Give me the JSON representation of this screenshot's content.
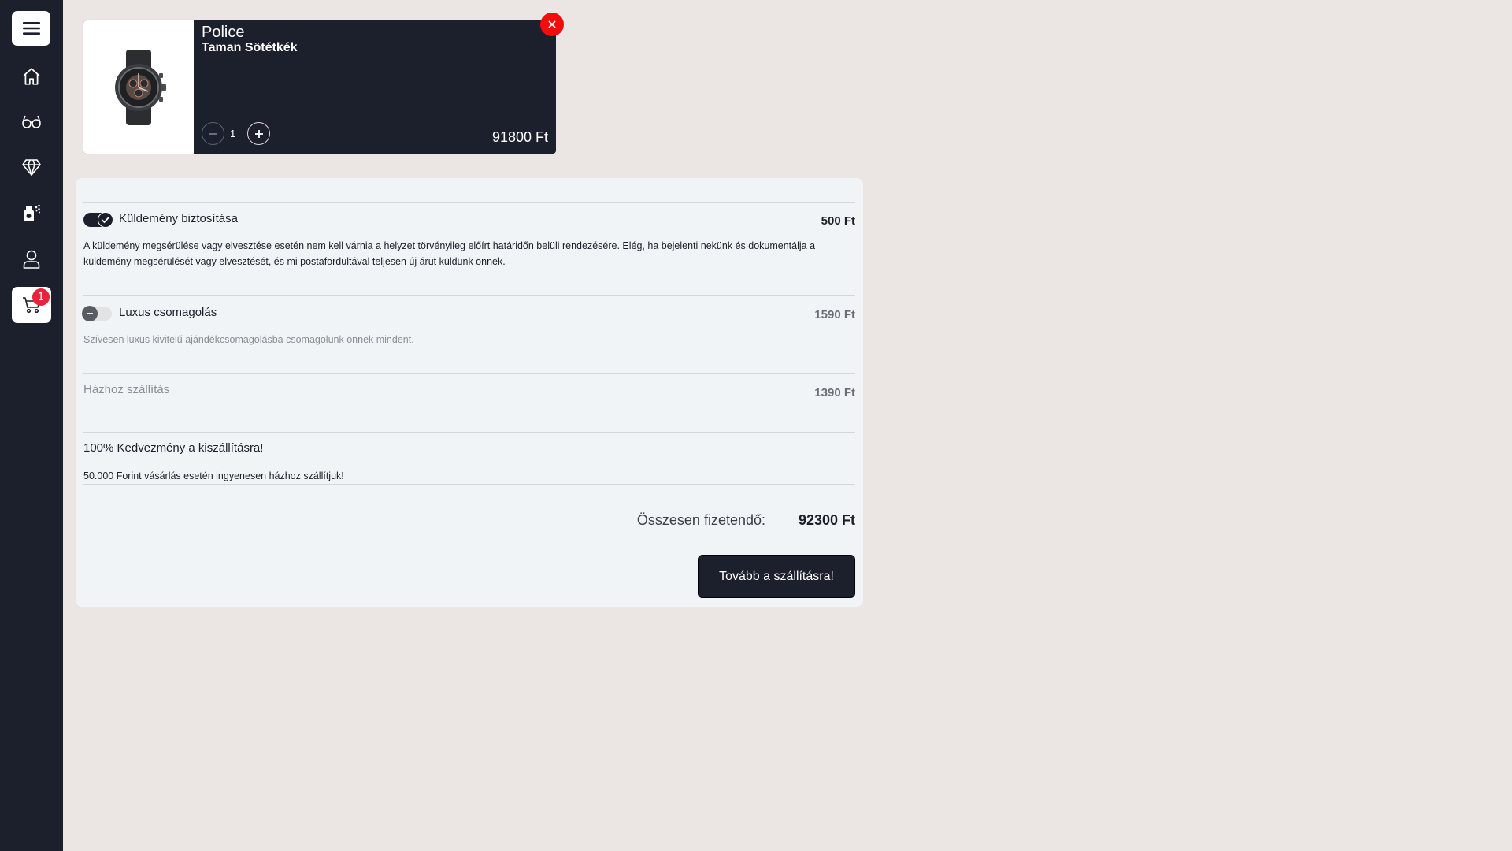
{
  "sidebar": {
    "items": [
      {
        "name": "menu",
        "icon": "hamburger-menu-icon"
      },
      {
        "name": "home",
        "icon": "home-icon"
      },
      {
        "name": "glasses",
        "icon": "glasses-icon"
      },
      {
        "name": "jewelry",
        "icon": "diamond-icon"
      },
      {
        "name": "perfume",
        "icon": "perfume-icon"
      },
      {
        "name": "account",
        "icon": "user-icon"
      },
      {
        "name": "cart",
        "icon": "cart-icon",
        "badge": "1"
      }
    ]
  },
  "cart_item": {
    "brand": "Police",
    "model": "Taman Sötétkék",
    "quantity": "1",
    "price": "91800 Ft",
    "image_icon": "wristwatch-icon"
  },
  "options": {
    "insurance": {
      "label": "Küldemény biztosítása",
      "price": "500 Ft",
      "enabled": true,
      "description": "A küldemény megsérülése vagy elvesztése esetén nem kell várnia a helyzet törvényileg előírt határidőn belüli rendezésére. Elég, ha bejelenti nekünk és dokumentálja a küldemény megsérülését vagy elvesztését, és mi postafordultával teljesen új árut küldünk önnek."
    },
    "gift_wrap": {
      "label": "Luxus csomagolás",
      "price": "1590 Ft",
      "enabled": false,
      "description": "Szívesen luxus kivitelű ajándékcsomagolásba csomagolunk önnek mindent."
    },
    "home_delivery": {
      "label": "Házhoz szállítás",
      "price": "1390 Ft"
    }
  },
  "promo": {
    "title": "100% Kedvezmény a kiszállításra!",
    "description": "50.000 Forint vásárlás esetén ingyenesen házhoz szállítjuk!"
  },
  "total": {
    "label": "Összesen fizetendő:",
    "value": "92300 Ft"
  },
  "cta_label": "Tovább a szállításra!",
  "colors": {
    "dark": "#1c1f2c",
    "background": "#ebe5e4",
    "panel": "#f1f4f7",
    "remove": "#f20d0d",
    "badge": "#e8243a"
  }
}
